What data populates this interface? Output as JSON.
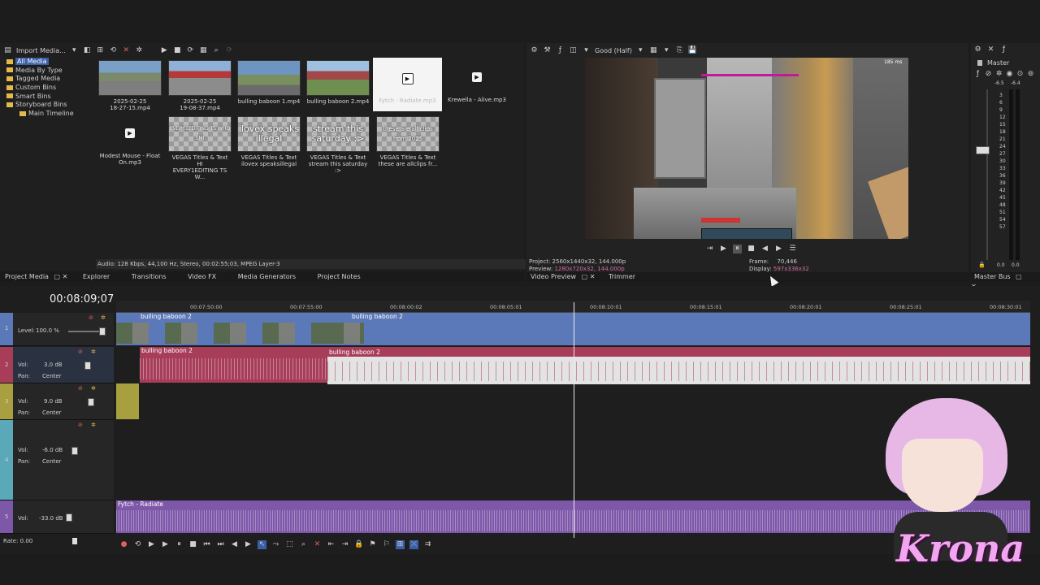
{
  "media_toolbar": {
    "import_label": "Import Media..."
  },
  "tree": {
    "all_media": "All Media",
    "items": [
      "Media By Type",
      "Tagged Media",
      "Custom Bins",
      "Smart Bins",
      "Storyboard Bins"
    ],
    "main_timeline": "Main Timeline"
  },
  "media_items": [
    {
      "caption": "2025-02-25\n18-27-15.mp4",
      "kind": "video"
    },
    {
      "caption": "2025-02-25\n19-08-37.mp4",
      "kind": "video"
    },
    {
      "caption": "bulling baboon 1.mp4",
      "kind": "video"
    },
    {
      "caption": "bulling baboon 2.mp4",
      "kind": "video"
    },
    {
      "caption": "Fytch - Radiate.mp3",
      "kind": "audio"
    },
    {
      "caption": "Krewella - Alive.mp3",
      "kind": "audio"
    },
    {
      "caption": "Modest Mouse - Float\nOn.mp3",
      "kind": "audio"
    },
    {
      "caption": "VEGAS Titles & Text HI\nEVERY1EDITING TS W...",
      "kind": "title",
      "overlay": "EVERY1EDITING TS WHO SMI"
    },
    {
      "caption": "VEGAS Titles & Text\nilovex speaksillegal",
      "kind": "title",
      "overlay": "ilovex speaks illegal"
    },
    {
      "caption": "VEGAS Titles & Text\nstream this saturday :>",
      "kind": "title",
      "overlay": "stream this saturday :>"
    },
    {
      "caption": "VEGAS Titles & Text\nthese are allclips fr...",
      "kind": "title",
      "overlay": "these are all clips from 2025"
    }
  ],
  "media_status": "Audio: 128 Kbps, 44,100 Hz, Stereo, 00:02:55;03, MPEG Layer-3",
  "left_tabs": [
    "Project Media",
    "Explorer",
    "Transitions",
    "Video FX",
    "Media Generators",
    "Project Notes"
  ],
  "preview": {
    "quality": "Good (Half)",
    "project_label": "Project:",
    "project_value": "2560x1440x32, 144.000p",
    "preview_label": "Preview:",
    "preview_value": "1280x720x32, 144.000p",
    "frame_label": "Frame:",
    "frame_value": "70,446",
    "display_label": "Display:",
    "display_value": "597x336x32",
    "tabs": [
      "Video Preview",
      "Trimmer"
    ],
    "hud_ms": "185 ms"
  },
  "master": {
    "title": "Master",
    "left_db": "-6.5",
    "right_db": "-6.4",
    "scale": [
      "3",
      "6",
      "9",
      "12",
      "15",
      "18",
      "21",
      "24",
      "27",
      "30",
      "33",
      "36",
      "39",
      "42",
      "45",
      "48",
      "51",
      "54",
      "57"
    ],
    "bottom_left": "0.0",
    "bottom_right": "0.0",
    "tab": "Master Bus"
  },
  "timeline": {
    "timecode": "00:08:09;07",
    "ruler": [
      "00:07:50:00",
      "00:07:55:00",
      "00:08:00:02",
      "00:08:05:01",
      "00:08:10:01",
      "00:08:15:01",
      "00:08:20:01",
      "00:08:25:01",
      "00:08:30:01"
    ],
    "tracks": [
      {
        "num": "1",
        "level_label": "Level:",
        "level": "100.0 %"
      },
      {
        "num": "2",
        "vol_label": "Vol:",
        "vol": "3.0 dB",
        "pan_label": "Pan:",
        "pan": "Center"
      },
      {
        "num": "3",
        "vol_label": "Vol:",
        "vol": "9.0 dB",
        "pan_label": "Pan:",
        "pan": "Center"
      },
      {
        "num": "4",
        "vol_label": "Vol:",
        "vol": "-6.0 dB",
        "pan_label": "Pan:",
        "pan": "Center"
      },
      {
        "num": "5",
        "vol_label": "Vol:",
        "vol": "-33.0 dB"
      }
    ],
    "clips": {
      "video_a": "bulling baboon 2",
      "video_b": "bulling baboon 2",
      "audio_a": "bulling baboon 2",
      "audio_b": "bulling baboon 2",
      "music": "Fytch - Radiate"
    },
    "rate_label": "Rate:",
    "rate": "0.00"
  },
  "overlay": {
    "name": "Krona"
  },
  "colors": {
    "video_track": "#5b79b8",
    "audio_track": "#a83d5a",
    "music_track": "#7d57a8",
    "accent": "#3b5fa7"
  }
}
